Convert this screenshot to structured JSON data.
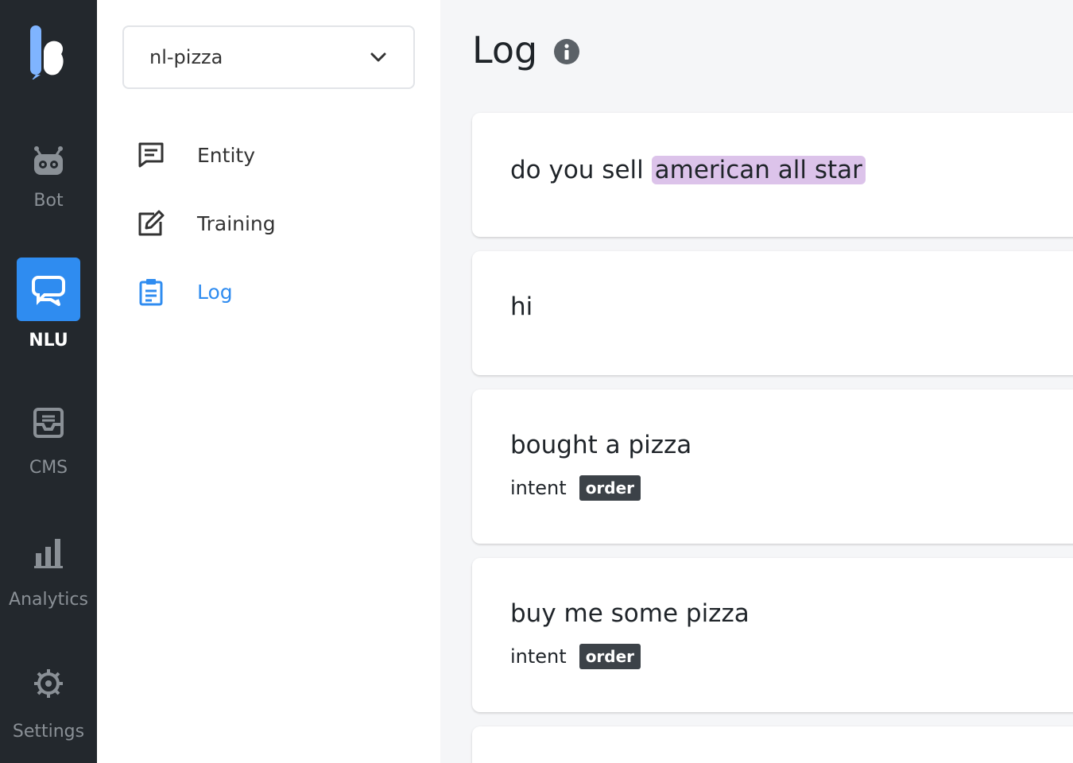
{
  "rail": {
    "items": [
      {
        "label": "Bot",
        "icon": "robot-icon"
      },
      {
        "label": "NLU",
        "icon": "chat-bubble-icon",
        "active": true
      },
      {
        "label": "CMS",
        "icon": "inbox-icon"
      },
      {
        "label": "Analytics",
        "icon": "bar-chart-icon"
      },
      {
        "label": "Settings",
        "icon": "gear-icon"
      }
    ],
    "active_color": "#2f8cf0",
    "bg_color": "#23282d"
  },
  "side": {
    "project_select": {
      "value": "nl-pizza"
    },
    "nav": [
      {
        "label": "Entity",
        "icon": "message-square-icon"
      },
      {
        "label": "Training",
        "icon": "edit-icon"
      },
      {
        "label": "Log",
        "icon": "clipboard-icon",
        "active": true
      }
    ]
  },
  "main": {
    "title": "Log",
    "logs": [
      {
        "pre": "do you sell ",
        "entity": "american all star"
      },
      {
        "text": "hi"
      },
      {
        "text": "bought a pizza",
        "meta_label": "intent",
        "intent": "order"
      },
      {
        "text": "buy me some pizza",
        "meta_label": "intent",
        "intent": "order"
      }
    ],
    "entity_highlight_color": "#dcc3ea"
  }
}
